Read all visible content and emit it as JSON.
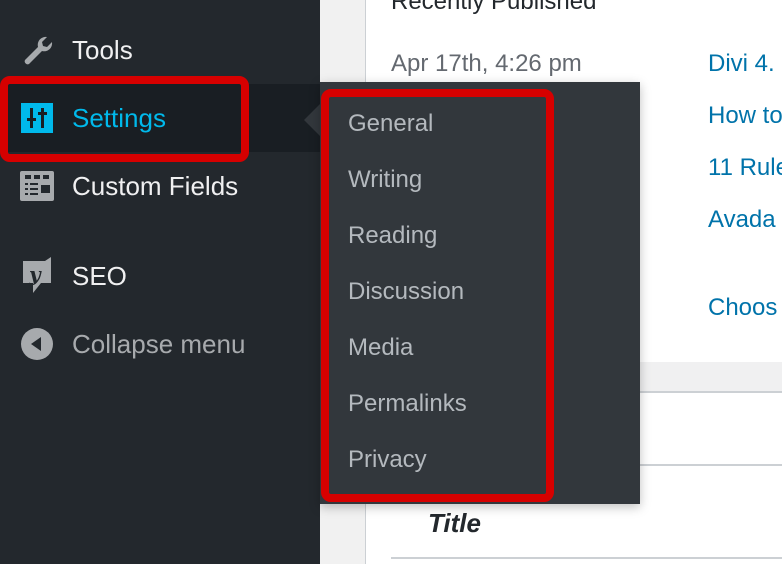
{
  "sidebar": {
    "items": [
      {
        "label": "Tools",
        "icon": "wrench-icon"
      },
      {
        "label": "Settings",
        "icon": "settings-sliders-icon",
        "active": true
      },
      {
        "label": "Custom Fields",
        "icon": "custom-fields-icon"
      },
      {
        "label": "SEO",
        "icon": "yoast-seo-icon"
      },
      {
        "label": "Collapse menu",
        "icon": "collapse-arrow-icon"
      }
    ]
  },
  "submenu": {
    "items": [
      {
        "label": "General"
      },
      {
        "label": "Writing"
      },
      {
        "label": "Reading"
      },
      {
        "label": "Discussion"
      },
      {
        "label": "Media"
      },
      {
        "label": "Permalinks"
      },
      {
        "label": "Privacy"
      }
    ]
  },
  "content": {
    "heading": "Recently Published",
    "date": "Apr 17th, 4:26 pm",
    "links": [
      "Divi 4.",
      "How to",
      "11 Rule",
      "Avada",
      "Choos"
    ],
    "table_header": "Title"
  },
  "colors": {
    "sidebar_bg": "#23282d",
    "active_accent": "#00b9eb",
    "highlight": "#d60000",
    "link": "#0073aa",
    "flyout_bg": "#32373c"
  }
}
